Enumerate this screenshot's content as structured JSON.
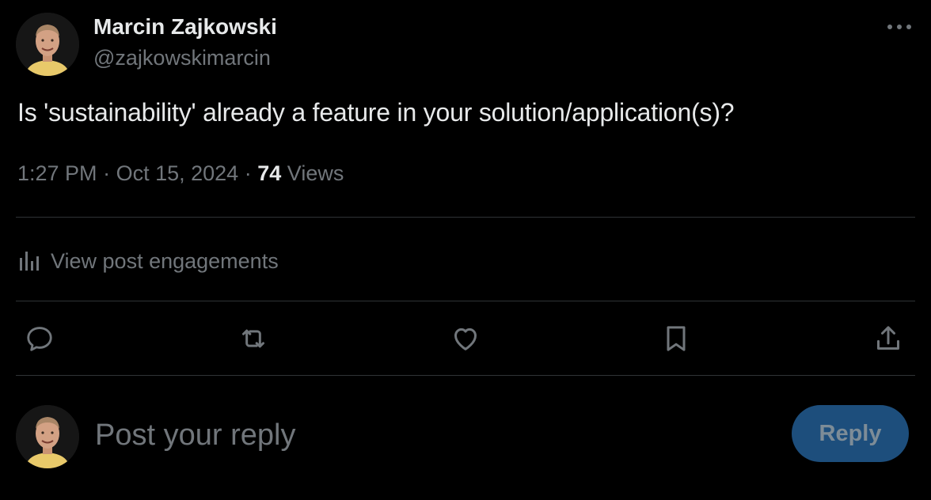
{
  "post": {
    "author": {
      "name": "Marcin Zajkowski",
      "handle": "@zajkowskimarcin"
    },
    "text": "Is 'sustainability' already a feature in your solution/application(s)?",
    "time": "1:27 PM",
    "date": "Oct 15, 2024",
    "separator": "·",
    "views_count": "74",
    "views_label": "Views"
  },
  "engagements": {
    "label": "View post engagements",
    "icon": "bar-chart-icon"
  },
  "actions": [
    {
      "name": "reply",
      "icon": "comment-icon"
    },
    {
      "name": "repost",
      "icon": "repost-icon"
    },
    {
      "name": "like",
      "icon": "heart-icon"
    },
    {
      "name": "bookmark",
      "icon": "bookmark-icon"
    },
    {
      "name": "share",
      "icon": "share-icon"
    }
  ],
  "reply_box": {
    "placeholder": "Post your reply",
    "button_label": "Reply"
  },
  "colors": {
    "background": "#000000",
    "text_primary": "#e7e9ea",
    "text_secondary": "#71767b",
    "divider": "#2f3336",
    "reply_button_bg": "#1d4e7c",
    "reply_button_text": "#7d8c97"
  }
}
